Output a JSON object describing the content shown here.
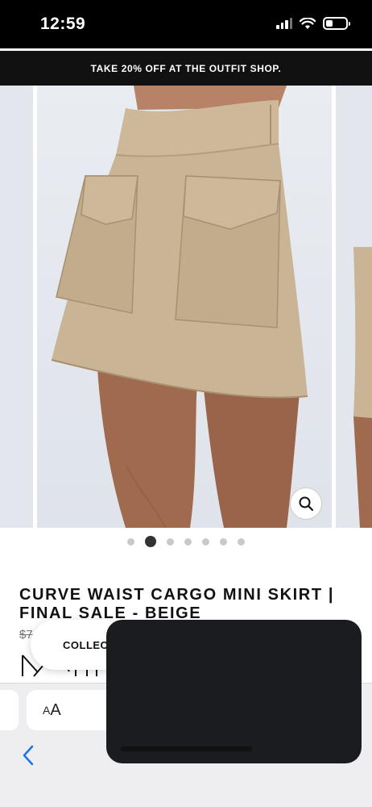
{
  "status_bar": {
    "time": "12:59",
    "icons": [
      "cellular-signal-icon",
      "wifi-icon",
      "battery-icon"
    ],
    "battery_level": 0.35
  },
  "promo_banner": {
    "text": "TAKE 20% OFF AT THE OUTFIT SHOP."
  },
  "gallery": {
    "image_subject": "beige cargo mini skirt",
    "slide_count": 7,
    "active_slide": 2,
    "zoom_icon": "magnifier-icon",
    "colors": {
      "skirt": "#c9b496",
      "skin": "#a06a4e",
      "backdrop": "#e5e8ee"
    }
  },
  "product": {
    "title": "CURVE WAIST CARGO MINI SKIRT | FINAL SALE - BEIGE",
    "price_partial": "$7"
  },
  "collection_pill": {
    "label": "COLLEC"
  },
  "browser_toolbar": {
    "aa_big": "A",
    "aa_small": "A",
    "back_icon": "chevron-left-icon",
    "accent": "#1a73e8"
  }
}
